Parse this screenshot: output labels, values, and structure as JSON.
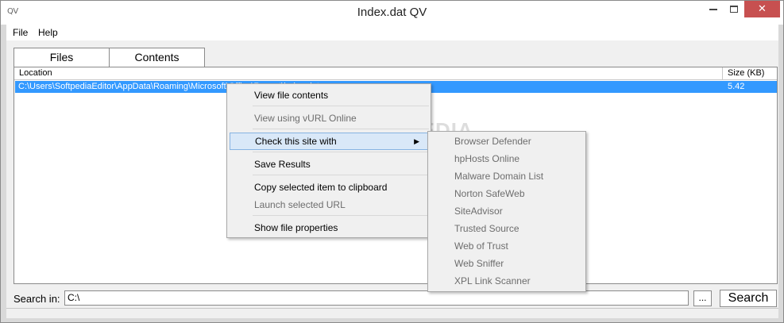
{
  "window": {
    "title": "Index.dat QV",
    "app_icon_text": "QV",
    "close_glyph": "✕"
  },
  "menubar": {
    "file": "File",
    "help": "Help"
  },
  "tabs": [
    {
      "label": "Files",
      "active": true
    },
    {
      "label": "Contents",
      "active": false
    }
  ],
  "listview": {
    "columns": [
      "Location",
      "Size (KB)"
    ],
    "rows": [
      {
        "location": "C:\\Users\\SoftpediaEditor\\AppData\\Roaming\\Microsoft\\Office\\Recent\\index.dat",
        "size": "5.42",
        "selected": true
      }
    ]
  },
  "context_menu": {
    "items": [
      {
        "label": "View file contents",
        "enabled": true
      },
      {
        "label": "View using vURL Online",
        "enabled": false
      },
      {
        "label": "Check this site with",
        "enabled": true,
        "has_submenu": true,
        "highlighted": true
      },
      {
        "label": "Save Results",
        "enabled": true
      },
      {
        "label": "Copy selected item to clipboard",
        "enabled": true
      },
      {
        "label": "Launch selected URL",
        "enabled": false
      },
      {
        "label": "Show file properties",
        "enabled": true
      }
    ],
    "submenu_arrow": "▶"
  },
  "submenu": {
    "items": [
      "Browser Defender",
      "hpHosts Online",
      "Malware Domain List",
      "Norton SafeWeb",
      "SiteAdvisor",
      "Trusted Source",
      "Web of Trust",
      "Web Sniffer",
      "XPL Link Scanner"
    ]
  },
  "search": {
    "label": "Search in:",
    "value": "C:\\",
    "browse_label": "...",
    "button_label": "Search"
  },
  "watermark": "SOFTPEDIA",
  "colors": {
    "selection": "#3399ff",
    "close_button": "#c75050",
    "menu_highlight": "#d9e8f8"
  }
}
